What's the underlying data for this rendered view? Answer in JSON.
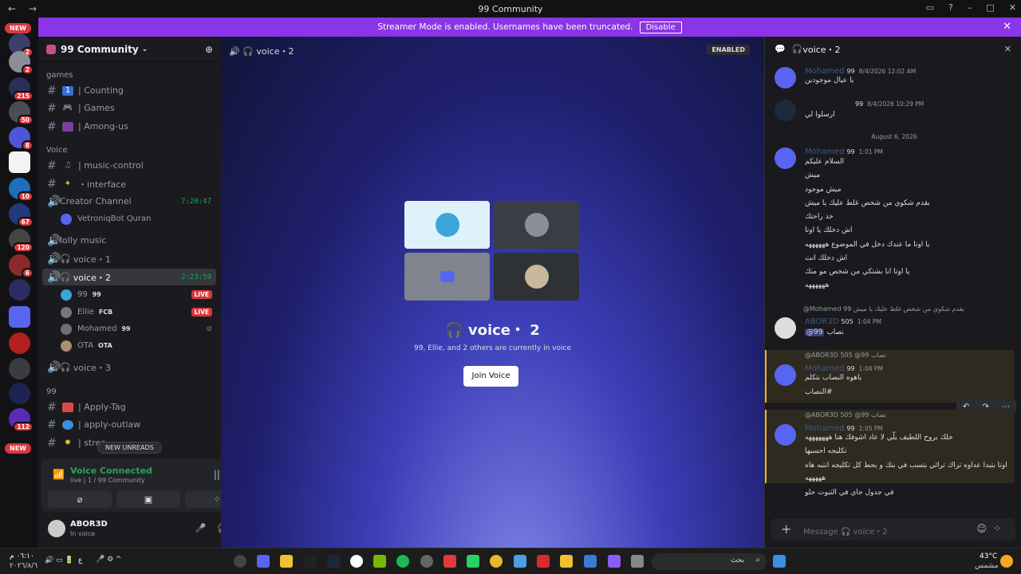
{
  "window": {
    "title": "99 Community"
  },
  "banner": {
    "text": "Streamer Mode is enabled. Usernames have been truncated.",
    "button": "Disable"
  },
  "servers": {
    "new_top": "NEW",
    "new_bottom": "NEW",
    "badges": [
      "2",
      "2",
      "215",
      "50",
      "8",
      "10",
      "67",
      "120",
      "6",
      "112"
    ]
  },
  "sidebar": {
    "server_name": "99 Community",
    "categories": {
      "games": "games",
      "voice": "Voice",
      "ninetynine": "99"
    },
    "channels": {
      "counting": "| Counting",
      "games": "| Games",
      "among": "| Among-us",
      "music_control": "| music-control",
      "interface": "・interface",
      "creator": "Creator Channel",
      "creator_time": "7:20:47",
      "lolly": "lolly music",
      "voice1": "voice・1",
      "voice2": "voice・2",
      "voice2_time": "2:23:59",
      "voice3": "voice・3",
      "apply_tag": "| Apply-Tag",
      "apply_outlaw": "| apply-outlaw",
      "stream": "| strea"
    },
    "creator_member": "VetroniqBot Quran",
    "members": [
      {
        "name": "99",
        "tag": "99",
        "live": "LIVE"
      },
      {
        "name": "Ellie",
        "tag": "FCB",
        "live": "LIVE"
      },
      {
        "name": "Mohamed",
        "tag": "99",
        "live": ""
      },
      {
        "name": "OTA",
        "tag": "OTA",
        "live": ""
      }
    ],
    "new_unreads": "NEW UNREADS"
  },
  "voice_panel": {
    "status": "Voice Connected",
    "sub": "live | 1 / 99 Community"
  },
  "user": {
    "name": "ABOR3D",
    "status": "In voice"
  },
  "main": {
    "channel": "voice・2",
    "enabled": "ENABLED",
    "title": "voice・ 2",
    "subtitle": "99, Ellie, and 2 others are currently in voice",
    "join": "Join Voice"
  },
  "chat": {
    "channel": "voice・2",
    "date_separator": "August 6, 2026",
    "messages": [
      {
        "name": "Mohamed",
        "badge": "99",
        "time": "8/4/2026 12:02 AM",
        "lines": [
          "يا عيال موجودين"
        ]
      },
      {
        "name": "",
        "badge": "99",
        "time": "8/4/2026 10:29 PM",
        "lines": [
          "ارسلوا لي"
        ]
      },
      {
        "name": "Mohamed",
        "badge": "99",
        "time": "1:01 PM",
        "lines": [
          "السلام عليكم",
          "ميش",
          "ميش موجود",
          "بقدم شكوي من شخص غلط عليك يا ميش",
          "خذ راحتك",
          "اش دخلك يا اوتا",
          "يا اوتا ما عندك دخل في الموضوع ههههههه",
          "اش دخلك انت",
          "يا اوتا انا بشتكي من شخص مو منك",
          "ههههههه"
        ]
      },
      {
        "reply": "@Mohamed 99 بقدم شكوي من شخص غلط عليك يا ميش",
        "name": "ABOR3D",
        "badge": "505",
        "time": "1:04 PM",
        "mention": "@99",
        "lines": [
          "نصاب"
        ]
      },
      {
        "reply": "@ABOR3D 505 @99 نصاب",
        "name": "Mohamed",
        "badge": "99",
        "time": "1:04 PM",
        "lines": [
          "ياهوه النصاب بتكلم",
          "النصاب#"
        ]
      },
      {
        "reply": "@ABOR3D 505 @99 نصاب",
        "name": "Mohamed",
        "badge": "99",
        "time": "1:05 PM",
        "lines": [
          "خلك بروح اللطيف يلّي لا عاد اشوفك هنا هههههههه",
          "تكليجه احسبها",
          "اوتا بتبدا عداوه تراك ترائي بتسب في بتك و بحط كل تكليجه انتبه هاه",
          "هههههه",
          "في جدول جاي في الثبوت حلو"
        ]
      }
    ],
    "input_placeholder": "Message 🎧 voice・2"
  },
  "taskbar": {
    "time": "٠٦:١٠ م",
    "date": "٢٠٢٦/٨/٦",
    "temp": "43°C",
    "weather": "مشمس",
    "search": "بحث",
    "lang": "ع"
  }
}
